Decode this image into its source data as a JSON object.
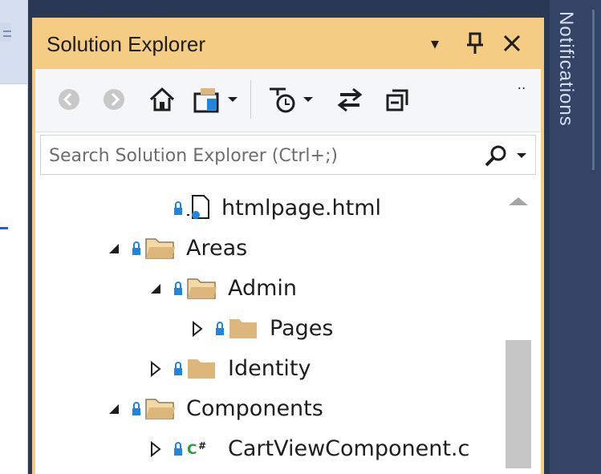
{
  "panel": {
    "title": "Solution Explorer",
    "dropdown_glyph": "▾",
    "pin_glyph": "⊥",
    "close_glyph": "✕"
  },
  "toolbar": {
    "items": [
      {
        "name": "back-icon"
      },
      {
        "name": "forward-icon"
      },
      {
        "name": "home-icon"
      },
      {
        "name": "switch-views-icon"
      },
      {
        "name": "pending-changes-filter-icon"
      },
      {
        "name": "sync-with-active-document-icon"
      },
      {
        "name": "collapse-all-icon"
      }
    ],
    "overflow_glyph": "‥"
  },
  "search": {
    "placeholder": "Search Solution Explorer (Ctrl+;)"
  },
  "tree": [
    {
      "label": "htmlpage.html",
      "type": "html-file",
      "expander": "none"
    },
    {
      "label": "Areas",
      "type": "folder-open",
      "expander": "expanded"
    },
    {
      "label": "Admin",
      "type": "folder-open",
      "expander": "expanded"
    },
    {
      "label": "Pages",
      "type": "folder",
      "expander": "collapsed"
    },
    {
      "label": "Identity",
      "type": "folder",
      "expander": "collapsed"
    },
    {
      "label": "Components",
      "type": "folder-open",
      "expander": "expanded"
    },
    {
      "label": "CartViewComponent.c",
      "type": "cs-file",
      "expander": "collapsed"
    }
  ],
  "side_tab": {
    "label": "Notifications"
  },
  "colors": {
    "title_bg": "#f5cc84",
    "lock": "#1f85de",
    "folder": "#dcb67a",
    "cs_green": "#2c9a3e",
    "frame": "#293955"
  }
}
